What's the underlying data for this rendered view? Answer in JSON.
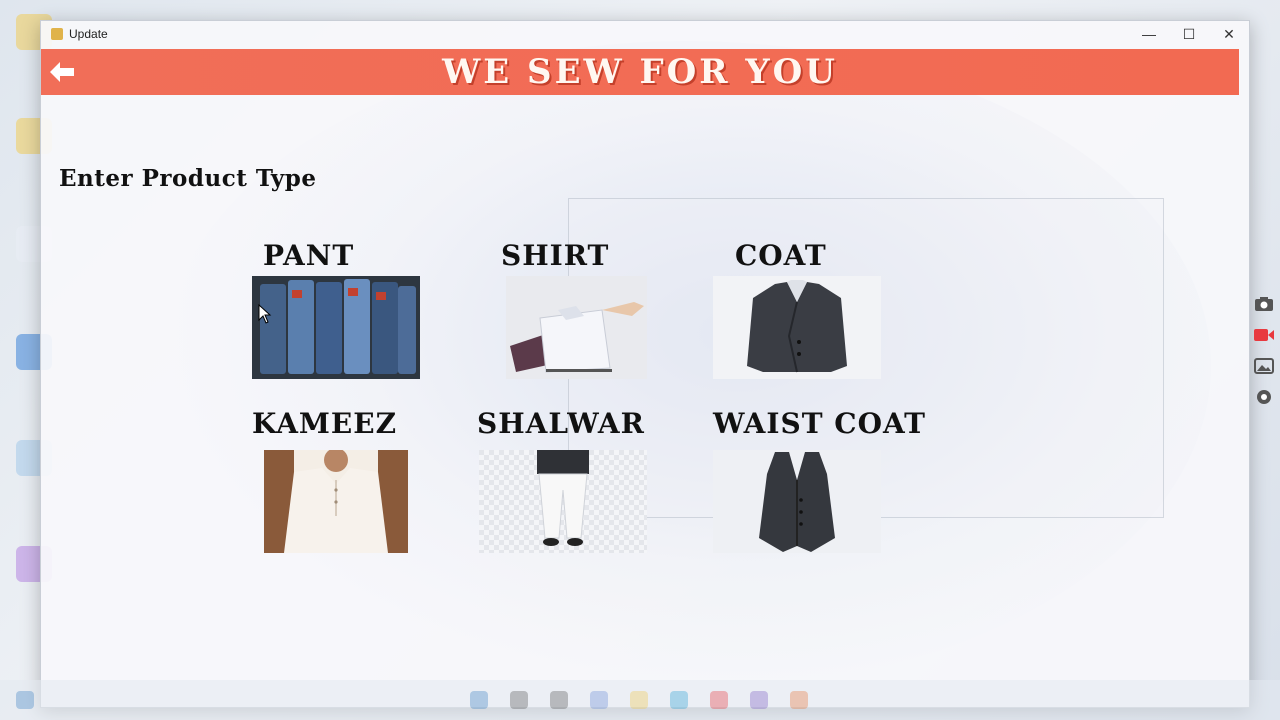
{
  "window": {
    "title": "Update",
    "minimize_glyph": "—",
    "maximize_glyph": "☐",
    "close_glyph": "✕"
  },
  "banner": {
    "title": "WE SEW FOR YOU",
    "color": "#f26a52"
  },
  "main": {
    "prompt": "Enter Product Type"
  },
  "products": [
    {
      "label": "PANT",
      "icon": "jeans-image"
    },
    {
      "label": "SHIRT",
      "icon": "shirt-image"
    },
    {
      "label": "COAT",
      "icon": "coat-image"
    },
    {
      "label": "KAMEEZ",
      "icon": "kameez-image"
    },
    {
      "label": "SHALWAR",
      "icon": "shalwar-image"
    },
    {
      "label": "WAIST COAT",
      "icon": "waistcoat-image"
    }
  ],
  "side_tools": [
    "camera-icon",
    "video-icon",
    "gallery-icon",
    "settings-icon"
  ],
  "colors": {
    "accent": "#f26a52",
    "record": "#e8393f"
  }
}
